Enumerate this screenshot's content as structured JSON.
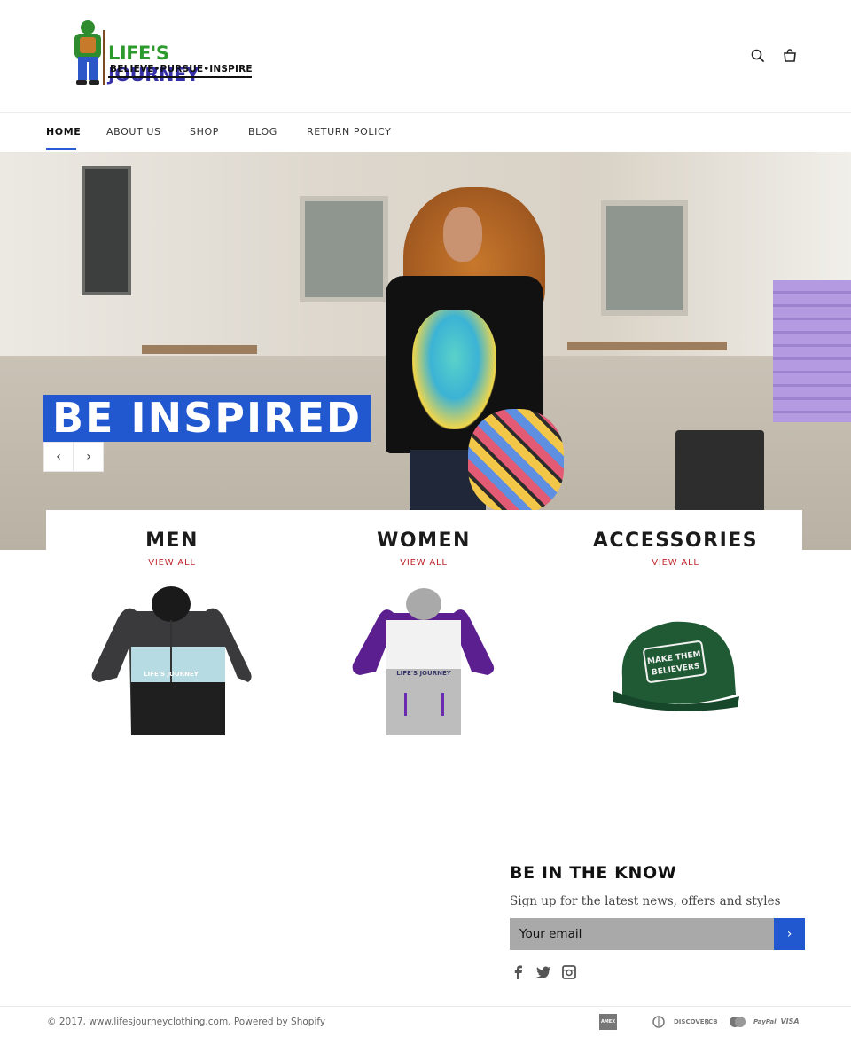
{
  "brand": {
    "name_part1": "LIFE'S ",
    "name_part2": "JOURNEY",
    "tagline": "BELIEVE•PURSUE•INSPIRE"
  },
  "header_icons": [
    "search-icon",
    "cart-icon"
  ],
  "nav": {
    "items": [
      {
        "label": "HOME",
        "active": true
      },
      {
        "label": "ABOUT US",
        "active": false
      },
      {
        "label": "SHOP",
        "active": false
      },
      {
        "label": "BLOG",
        "active": false
      },
      {
        "label": "RETURN POLICY",
        "active": false
      }
    ]
  },
  "hero": {
    "caption": "BE INSPIRED",
    "prev_icon": "‹",
    "next_icon": "›"
  },
  "collections": [
    {
      "title": "MEN",
      "link": "VIEW ALL",
      "image": "jacket-black-grey-icon"
    },
    {
      "title": "WOMEN",
      "link": "VIEW ALL",
      "image": "jacket-purple-grey-icon"
    },
    {
      "title": "ACCESSORIES",
      "link": "VIEW ALL",
      "image": "green-cap-icon",
      "cap_text_1": "MAKE THEM",
      "cap_text_2": "BELIEVERS"
    }
  ],
  "jacket_print": "LIFE'S JOURNEY",
  "newsletter": {
    "title": "BE IN THE KNOW",
    "subtitle": "Sign up for the latest news, offers and styles",
    "placeholder": "Your email",
    "submit_icon": "›"
  },
  "social": [
    "facebook-icon",
    "twitter-icon",
    "instagram-icon"
  ],
  "footer": {
    "copyright": "© 2017, www.lifesjourneyclothing.com. Powered by Shopify",
    "payments": [
      "AMEX",
      "DINERS",
      "DISCOVER",
      "JCB",
      "MASTER",
      "PayPal",
      "VISA"
    ]
  },
  "colors": {
    "accent": "#2158cf",
    "view_all": "#c0272d",
    "logo_green": "#2c9a2c",
    "logo_blue": "#3530a8"
  }
}
